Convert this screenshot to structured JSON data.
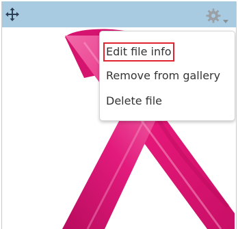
{
  "toolbar": {
    "move_icon": "move-icon",
    "gear_icon": "gear-icon",
    "dropdown_icon": "caret-down-icon",
    "background_color": "#a9cbe2"
  },
  "menu": {
    "items": [
      {
        "label": "Edit file info",
        "highlighted": true
      },
      {
        "label": "Remove from gallery",
        "highlighted": false
      },
      {
        "label": "Delete file",
        "highlighted": false
      }
    ],
    "highlight_color": "#e0242f"
  },
  "image": {
    "subject": "pink ribbon",
    "primary_color": "#e8187a"
  }
}
